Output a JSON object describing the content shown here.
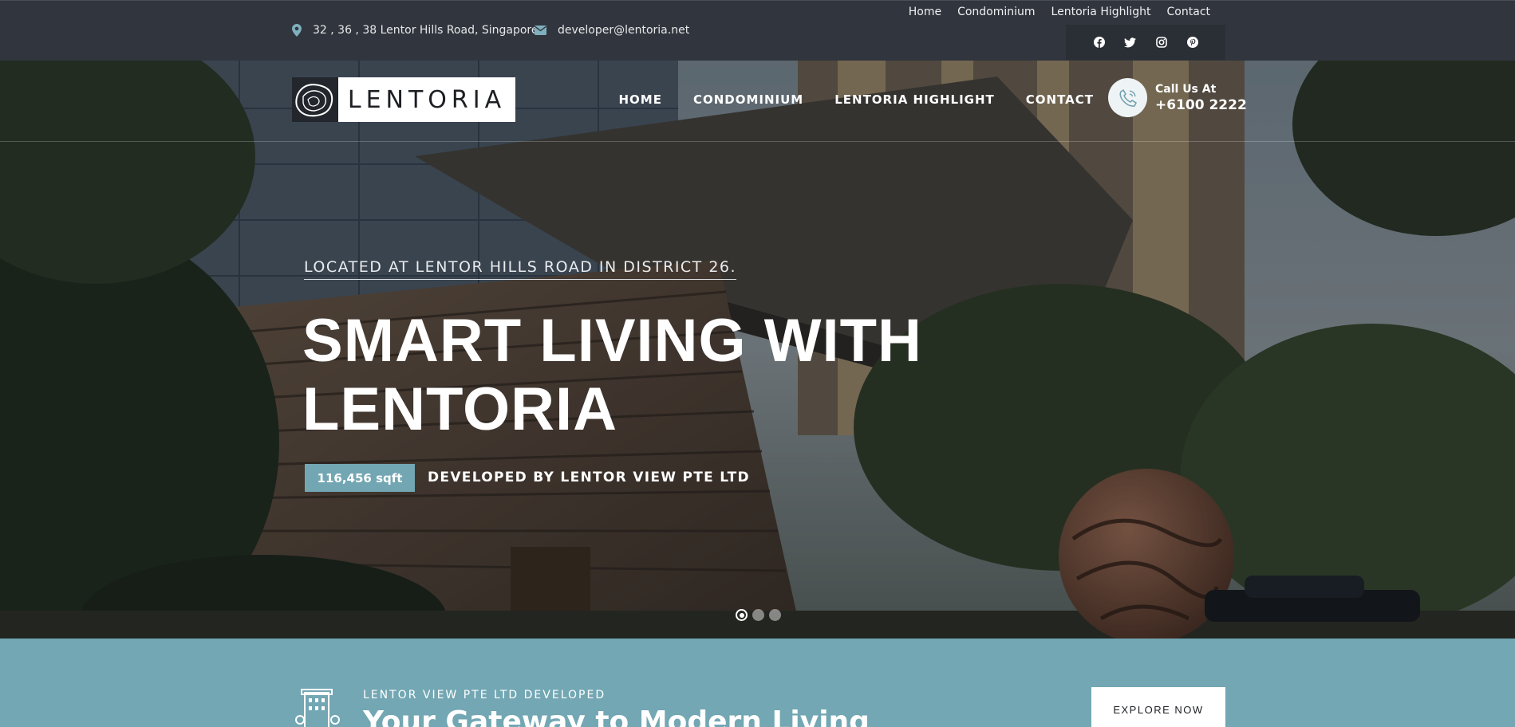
{
  "topbar": {
    "address": "32 , 36 , 38 Lentor Hills Road, Singapore",
    "email": "developer@lentoria.net",
    "links": [
      "Home",
      "Condominium",
      "Lentoria Highlight",
      "Contact"
    ],
    "socials": [
      "facebook-icon",
      "twitter-icon",
      "instagram-icon",
      "pinterest-icon"
    ]
  },
  "header": {
    "logo_text": "LENTORIA",
    "nav": [
      "HOME",
      "CONDOMINIUM",
      "LENTORIA HIGHLIGHT",
      "CONTACT"
    ],
    "call_label": "Call Us At",
    "call_number": "+6100 2222"
  },
  "hero": {
    "kicker": "LOCATED AT LENTOR HILLS ROAD IN DISTRICT 26.",
    "headline_line1": "SMART LIVING WITH",
    "headline_line2": "LENTORIA",
    "badge": "116,456 sqft",
    "developed_by": "DEVELOPED BY LENTOR VIEW PTE LTD",
    "slides_total": 3,
    "slide_active": 1
  },
  "band": {
    "kicker": "LENTOR VIEW PTE LTD DEVELOPED",
    "title": "Your Gateway to Modern Living",
    "button": "EXPLORE NOW"
  },
  "colors": {
    "accent": "#73a6b3",
    "topbar": "#31353d",
    "band": "#72a7b3"
  }
}
